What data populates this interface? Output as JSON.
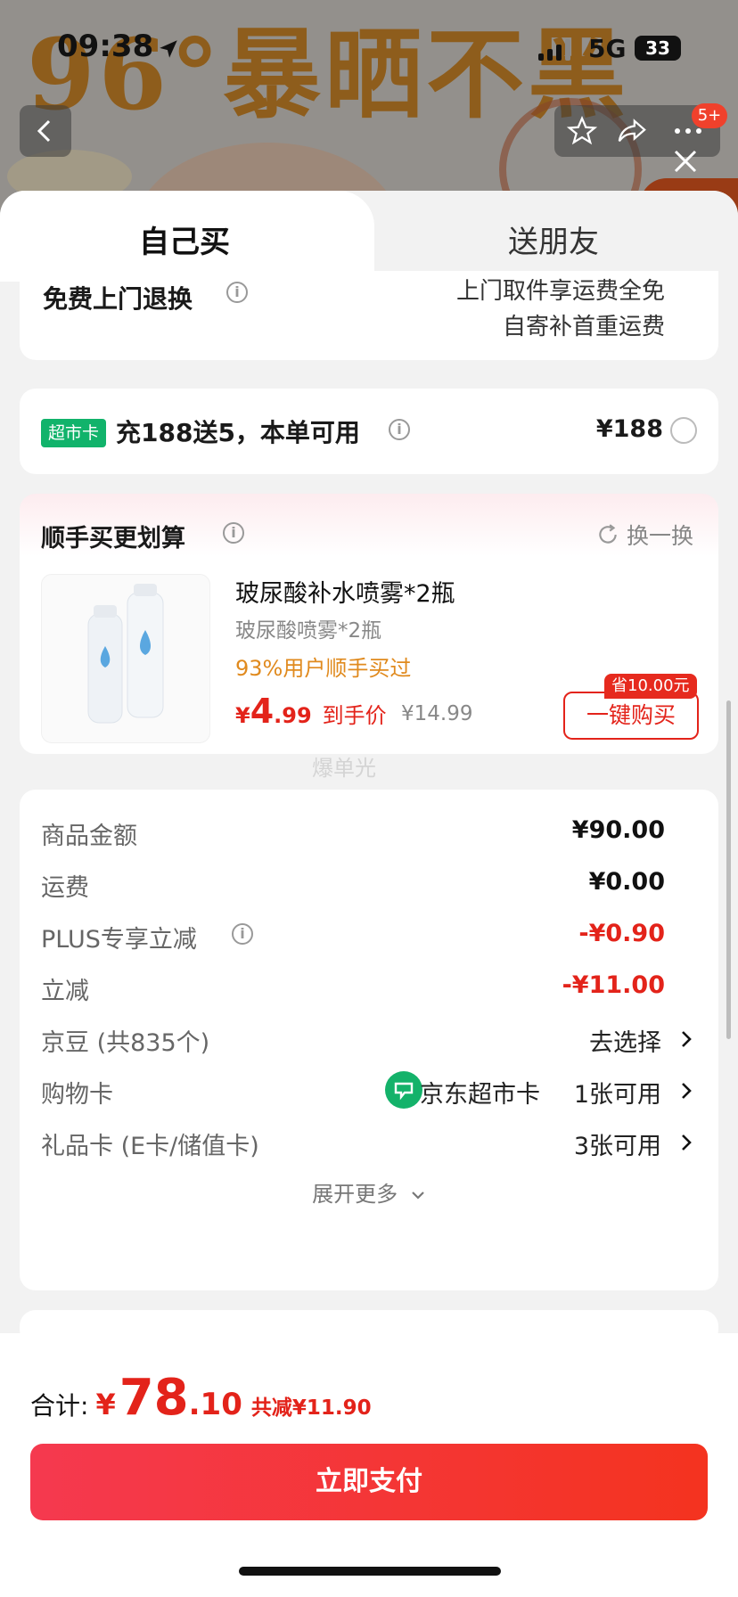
{
  "status_bar": {
    "time": "09:38",
    "network": "5G",
    "battery": "33"
  },
  "background": {
    "banner_text": "96°暴晒不黑",
    "cart_badge": "5+"
  },
  "tabs": {
    "self": "自己买",
    "gift": "送朋友"
  },
  "return_service": {
    "title": "免费上门退换",
    "line1": "上门取件享运费全免",
    "line2": "自寄补首重运费"
  },
  "supermarket_card": {
    "tag": "超市卡",
    "text": "充188送5，本单可用",
    "price": "¥188"
  },
  "addon": {
    "title": "顺手买更划算",
    "swap_label": "换一换",
    "product_name": "玻尿酸补水喷雾*2瓶",
    "product_sub": "玻尿酸喷雾*2瓶",
    "bought_hint": "93%用户顺手买过",
    "price_symbol": "¥",
    "price_int": "4",
    "price_dec": ".99",
    "price_label": "到手价",
    "original_price": "¥14.99",
    "save_tag": "省10.00元",
    "buy_button": "一键购买",
    "watermark": "爆单光"
  },
  "summary": {
    "rows": [
      {
        "label": "商品金额",
        "value": "¥90.00"
      },
      {
        "label": "运费",
        "value": "¥0.00"
      },
      {
        "label": "PLUS专享立减",
        "value": "-¥0.90"
      },
      {
        "label": "立减",
        "value": "-¥11.00"
      },
      {
        "label": "京豆 (共835个)",
        "value": "去选择"
      },
      {
        "label": "购物卡",
        "card_name": "京东超市卡",
        "value": "1张可用"
      },
      {
        "label": "礼品卡 (E卡/储值卡)",
        "value": "3张可用"
      }
    ],
    "expand": "展开更多"
  },
  "footer": {
    "total_label": "合计:",
    "total_symbol": "¥",
    "total_int": "78",
    "total_dec": ".10",
    "total_save": "共减¥11.90",
    "pay_button": "立即支付"
  },
  "colors": {
    "accent_red": "#e3231a",
    "green": "#11b36b",
    "pay_gradient_start": "#f5394f",
    "pay_gradient_end": "#f4331f"
  }
}
